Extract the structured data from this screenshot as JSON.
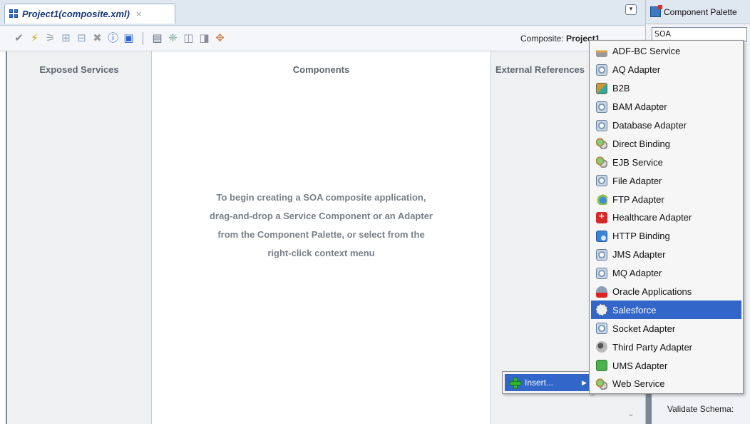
{
  "editor": {
    "tab_title": "Project1(composite.xml)",
    "tab_close": "×",
    "composite_prefix": "Composite:",
    "composite_name": "Project1"
  },
  "lanes": {
    "left_title": "Exposed Services",
    "middle_title": "Components",
    "right_title": "External References"
  },
  "hint": {
    "line1": "To begin creating a SOA composite application,",
    "line2": "drag-and-drop a Service Component or an Adapter",
    "line3": "from the Component Palette, or select from the",
    "line4": "right-click context menu"
  },
  "palette": {
    "title": "Component Palette",
    "selected_category": "SOA",
    "validate_label": "Validate Schema:"
  },
  "context_menu": {
    "insert_label": "Insert..."
  },
  "submenu": {
    "items": [
      {
        "label": "ADF-BC Service",
        "icon": "adfbc-icon"
      },
      {
        "label": "AQ Adapter",
        "icon": "aq-adapter-icon"
      },
      {
        "label": "B2B",
        "icon": "b2b-icon"
      },
      {
        "label": "BAM Adapter",
        "icon": "bam-adapter-icon"
      },
      {
        "label": "Database Adapter",
        "icon": "database-adapter-icon"
      },
      {
        "label": "Direct Binding",
        "icon": "direct-binding-icon"
      },
      {
        "label": "EJB Service",
        "icon": "ejb-service-icon"
      },
      {
        "label": "File Adapter",
        "icon": "file-adapter-icon"
      },
      {
        "label": "FTP Adapter",
        "icon": "ftp-adapter-icon"
      },
      {
        "label": "Healthcare Adapter",
        "icon": "healthcare-adapter-icon"
      },
      {
        "label": "HTTP Binding",
        "icon": "http-binding-icon"
      },
      {
        "label": "JMS Adapter",
        "icon": "jms-adapter-icon"
      },
      {
        "label": "MQ Adapter",
        "icon": "mq-adapter-icon"
      },
      {
        "label": "Oracle Applications",
        "icon": "oracle-applications-icon"
      },
      {
        "label": "Salesforce",
        "icon": "salesforce-icon"
      },
      {
        "label": "Socket Adapter",
        "icon": "socket-adapter-icon"
      },
      {
        "label": "Third Party Adapter",
        "icon": "third-party-adapter-icon"
      },
      {
        "label": "UMS Adapter",
        "icon": "ums-adapter-icon"
      },
      {
        "label": "Web Service",
        "icon": "web-service-icon"
      }
    ],
    "selected": "Salesforce"
  },
  "colors": {
    "selection": "#3266c8",
    "lane_bg": "#eef0f2",
    "lane_title": "#5f6770"
  }
}
